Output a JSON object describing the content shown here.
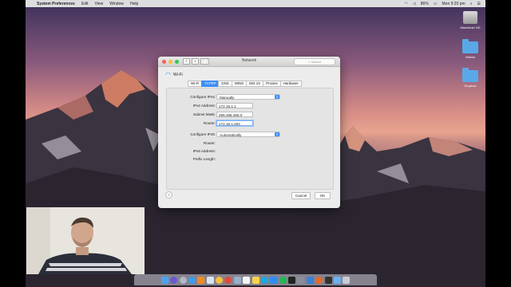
{
  "menubar": {
    "app_name": "System Preferences",
    "items": [
      "Edit",
      "View",
      "Window",
      "Help"
    ],
    "battery": "86%",
    "clock": "Mon 9:20 pm"
  },
  "desktop": {
    "icons": [
      {
        "label": "Macintosh HD",
        "icon": "hard-drive-icon"
      },
      {
        "label": "Videos",
        "icon": "folder-icon"
      },
      {
        "label": "Dropbox",
        "icon": "folder-icon"
      }
    ]
  },
  "window": {
    "title": "Network",
    "search_placeholder": "Search",
    "interface_name": "Wi-Fi",
    "tabs": [
      {
        "label": "Wi-Fi",
        "selected": false
      },
      {
        "label": "TCP/IP",
        "selected": true
      },
      {
        "label": "DNS",
        "selected": false
      },
      {
        "label": "WINS",
        "selected": false
      },
      {
        "label": "802.1X",
        "selected": false
      },
      {
        "label": "Proxies",
        "selected": false
      },
      {
        "label": "Hardware",
        "selected": false
      }
    ],
    "tcpip": {
      "configure_ipv4_label": "Configure IPv4:",
      "configure_ipv4_value": "Manually",
      "ipv4_address_label": "IPv4 Address:",
      "ipv4_address_value": "172.16.1.1",
      "subnet_mask_label": "Subnet Mask:",
      "subnet_mask_value": "255.255.255.0",
      "router_label": "Router:",
      "router_value": "172.16.1.254",
      "configure_ipv6_label": "Configure IPv6:",
      "configure_ipv6_value": "Automatically",
      "router6_label": "Router:",
      "ipv6_address_label": "IPv6 Address:",
      "prefix_length_label": "Prefix Length:"
    },
    "help_label": "?",
    "cancel_label": "Cancel",
    "ok_label": "OK"
  },
  "colors": {
    "accent": "#3d8ef4",
    "close": "#fc5f57",
    "minimize": "#fdbc2e",
    "zoom": "#33c748"
  },
  "dock": {
    "icons": [
      "finder-icon",
      "siri-icon",
      "launchpad-icon",
      "safari-icon",
      "vlc-icon",
      "mail-icon",
      "photos-icon",
      "chrome-icon",
      "preview-icon",
      "calendar-icon",
      "notes-icon",
      "skype-icon",
      "app-store-icon",
      "spotify-icon",
      "terminal-icon",
      "system-preferences-icon",
      "xcode-icon",
      "firefox-icon",
      "activity-monitor-icon",
      "downloads-folder-icon",
      "trash-icon"
    ]
  }
}
